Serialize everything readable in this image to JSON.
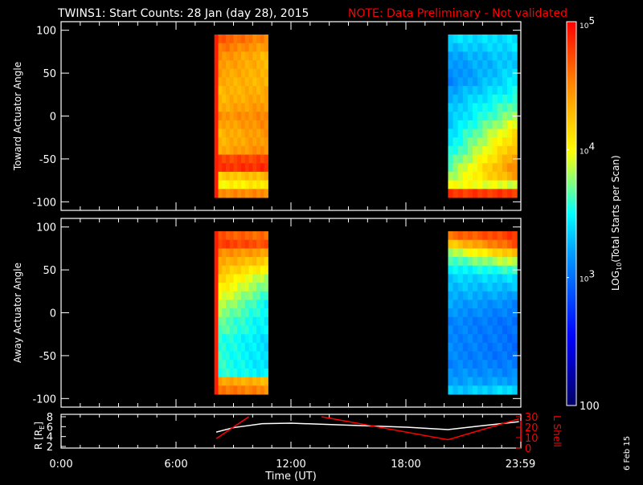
{
  "chart_data": {
    "type": "heatmap",
    "title": "TWINS1: Start Counts: 28 Jan (day  28), 2015",
    "note": "NOTE: Data Preliminary - Not validated",
    "date_stamp": "6 Feb 15",
    "xlabel": "Time (UT)",
    "x_range_hours": [
      0,
      24
    ],
    "x_ticks": [
      {
        "h": 0,
        "label": "0:00"
      },
      {
        "h": 6,
        "label": "6:00"
      },
      {
        "h": 12,
        "label": "12:00"
      },
      {
        "h": 18,
        "label": "18:00"
      },
      {
        "h": 23.98,
        "label": "23:59"
      }
    ],
    "colorbar": {
      "label": "LOG10(Total Starts per Scan)",
      "label_main": "LOG",
      "label_sub": "10",
      "label_rest": "(Total Starts per Scan)",
      "range_log10": [
        2,
        5
      ],
      "ticks": [
        {
          "v": 5,
          "label": "10",
          "exp": "5"
        },
        {
          "v": 4,
          "label": "10",
          "exp": "4"
        },
        {
          "v": 3,
          "label": "10",
          "exp": "3"
        },
        {
          "v": 2,
          "label": "100",
          "exp": ""
        }
      ]
    },
    "panels": [
      {
        "ylabel": "Toward Actuator Angle",
        "y_range": [
          -110,
          110
        ],
        "y_ticks": [
          "100",
          "50",
          "0",
          "-50",
          "-100"
        ],
        "blocks": [
          {
            "t_start": 8.0,
            "t_end": 10.8,
            "angles": [
              90,
              80,
              70,
              60,
              50,
              40,
              30,
              20,
              10,
              0,
              -10,
              -20,
              -30,
              -40,
              -50,
              -60,
              -70,
              -80,
              -90
            ],
            "start": [
              4.7,
              4.6,
              4.5,
              4.45,
              4.4,
              4.35,
              4.3,
              4.3,
              4.35,
              4.45,
              4.35,
              4.3,
              4.3,
              4.35,
              4.75,
              4.8,
              4.2,
              4.0,
              4.5
            ],
            "end": [
              4.5,
              4.4,
              4.3,
              4.3,
              4.3,
              4.3,
              4.35,
              4.4,
              4.45,
              4.5,
              4.5,
              4.45,
              4.45,
              4.5,
              4.75,
              4.85,
              4.3,
              4.1,
              4.5
            ]
          },
          {
            "t_start": 20.2,
            "t_end": 23.8,
            "angles": [
              90,
              80,
              70,
              60,
              50,
              40,
              30,
              20,
              10,
              0,
              -10,
              -20,
              -30,
              -40,
              -50,
              -60,
              -70,
              -80,
              -90
            ],
            "start": [
              3.4,
              3.3,
              3.2,
              3.15,
              3.1,
              3.1,
              3.2,
              3.25,
              3.3,
              3.3,
              3.35,
              3.4,
              3.45,
              3.5,
              3.6,
              3.7,
              3.8,
              4.0,
              4.8
            ],
            "end": [
              3.4,
              3.4,
              3.35,
              3.35,
              3.4,
              3.45,
              3.5,
              3.6,
              3.7,
              3.8,
              3.95,
              4.1,
              4.2,
              4.3,
              4.4,
              4.5,
              4.4,
              3.9,
              4.8
            ]
          }
        ]
      },
      {
        "ylabel": "Away Actuator Angle",
        "y_range": [
          -110,
          110
        ],
        "y_ticks": [
          "100",
          "50",
          "0",
          "-50",
          "-100"
        ],
        "blocks": [
          {
            "t_start": 8.0,
            "t_end": 10.8,
            "angles": [
              90,
              80,
              70,
              60,
              50,
              40,
              30,
              20,
              10,
              0,
              -10,
              -20,
              -30,
              -40,
              -50,
              -60,
              -70,
              -80,
              -90
            ],
            "start": [
              4.7,
              4.8,
              4.5,
              4.4,
              4.3,
              4.2,
              4.1,
              4.0,
              3.9,
              3.8,
              3.7,
              3.7,
              3.6,
              3.6,
              3.6,
              3.6,
              3.6,
              4.4,
              4.6
            ],
            "end": [
              4.6,
              4.7,
              4.4,
              4.2,
              4.0,
              3.8,
              3.7,
              3.6,
              3.5,
              3.5,
              3.45,
              3.45,
              3.4,
              3.4,
              3.4,
              3.4,
              3.45,
              4.3,
              4.5
            ]
          },
          {
            "t_start": 20.2,
            "t_end": 23.8,
            "angles": [
              90,
              80,
              70,
              60,
              50,
              40,
              30,
              20,
              10,
              0,
              -10,
              -20,
              -30,
              -40,
              -50,
              -60,
              -70,
              -80,
              -90
            ],
            "start": [
              4.6,
              4.2,
              3.8,
              3.6,
              3.45,
              3.35,
              3.3,
              3.25,
              3.2,
              3.15,
              3.1,
              3.1,
              3.1,
              3.1,
              3.1,
              3.1,
              3.15,
              3.2,
              3.3
            ],
            "end": [
              4.8,
              4.7,
              4.3,
              3.9,
              3.6,
              3.4,
              3.3,
              3.2,
              3.1,
              3.05,
              3.0,
              3.0,
              3.0,
              3.0,
              3.0,
              3.05,
              3.1,
              3.2,
              3.4
            ]
          }
        ]
      }
    ],
    "orbit_panel": {
      "left_label": "R [R",
      "left_sub": "E",
      "left_close": "]",
      "right_label": "L Shell",
      "r_ticks": [
        "8",
        "6",
        "4",
        "2"
      ],
      "r_range": [
        2,
        8
      ],
      "l_ticks": [
        "30",
        "20",
        "10",
        "0"
      ],
      "l_range": [
        0,
        30
      ],
      "series": [
        {
          "name": "R",
          "color": "#ffffff",
          "x": [
            8.1,
            9.0,
            10.5,
            12.0,
            15.0,
            18.0,
            20.2,
            22.0,
            23.9
          ],
          "y": [
            4.9,
            5.8,
            6.6,
            6.7,
            6.3,
            5.9,
            5.4,
            6.2,
            7.0
          ]
        },
        {
          "name": "L Shell",
          "color": "#ff0000",
          "x": [
            8.1,
            9.8
          ],
          "y": [
            9,
            30
          ]
        },
        {
          "name": "L Shell",
          "color": "#ff0000",
          "x": [
            13.6,
            20.2,
            23.9
          ],
          "y": [
            30,
            8,
            28
          ]
        }
      ]
    },
    "colors": {
      "note": "#ff0000",
      "axis": "#ffffff",
      "lshell": "#ff0000"
    }
  }
}
